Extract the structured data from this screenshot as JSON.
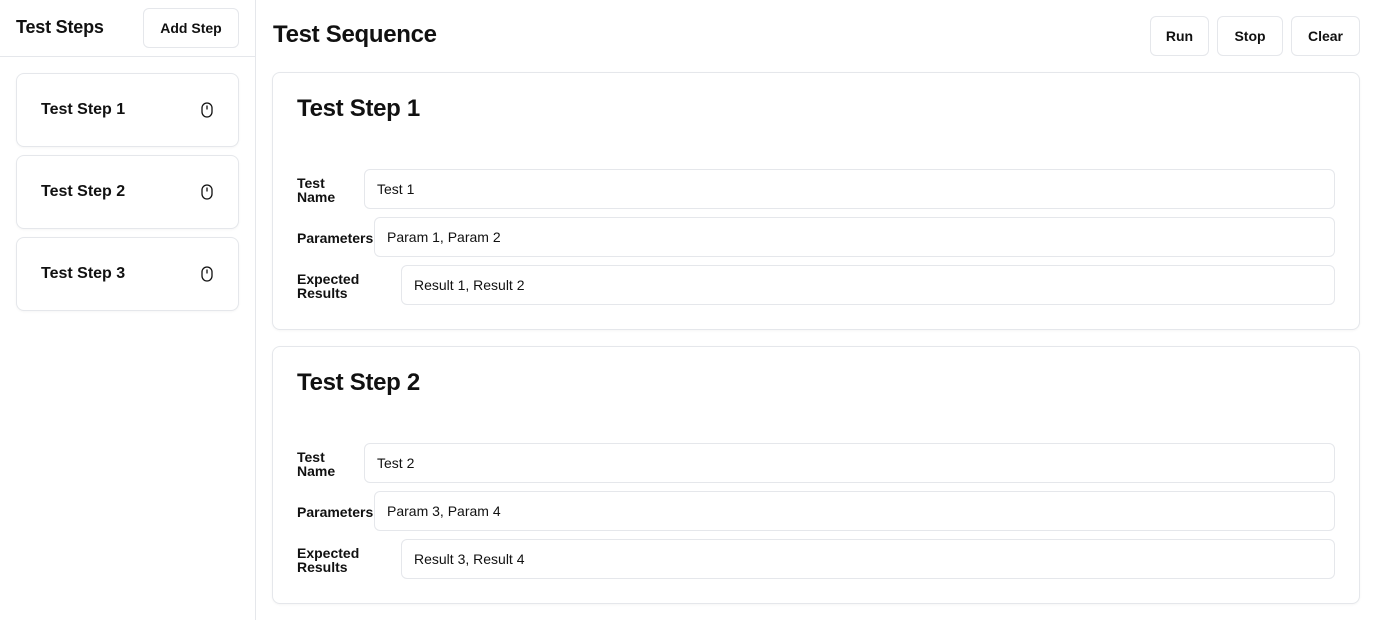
{
  "sidebar": {
    "title": "Test Steps",
    "add_step_label": "Add Step",
    "items": [
      {
        "label": "Test Step 1",
        "icon": "mouse-icon"
      },
      {
        "label": "Test Step 2",
        "icon": "mouse-icon"
      },
      {
        "label": "Test Step 3",
        "icon": "mouse-icon"
      }
    ]
  },
  "main": {
    "title": "Test Sequence",
    "toolbar": {
      "run_label": "Run",
      "stop_label": "Stop",
      "clear_label": "Clear"
    },
    "cards": [
      {
        "title": "Test Step 1",
        "test_name_label_line1": "Test",
        "test_name_label_line2": "Name",
        "test_name_value": "Test 1",
        "parameters_label": "Parameters",
        "parameters_value": "Param 1, Param 2",
        "expected_label_line1": "Expected",
        "expected_label_line2": "Results",
        "expected_value": "Result 1, Result 2"
      },
      {
        "title": "Test Step 2",
        "test_name_label_line1": "Test",
        "test_name_label_line2": "Name",
        "test_name_value": "Test 2",
        "parameters_label": "Parameters",
        "parameters_value": "Param 3, Param 4",
        "expected_label_line1": "Expected",
        "expected_label_line2": "Results",
        "expected_value": "Result 3, Result 4"
      }
    ]
  }
}
